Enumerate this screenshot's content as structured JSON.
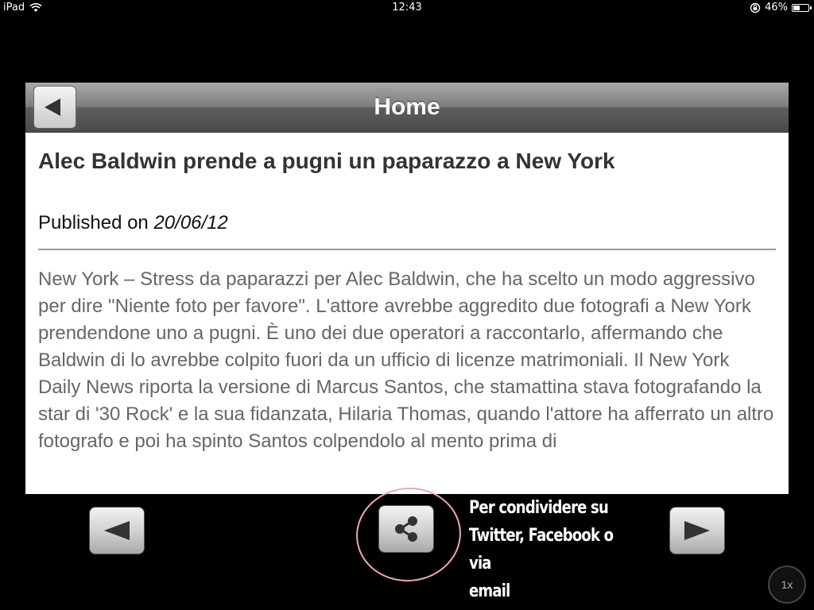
{
  "status_bar": {
    "device": "iPad",
    "time": "12:43",
    "battery": "46%",
    "battery_level": 0.46,
    "icons": [
      "wifi-icon",
      "orientation-lock-icon",
      "battery-icon"
    ]
  },
  "nav": {
    "title": "Home",
    "back_icon": "back-arrow-icon"
  },
  "article": {
    "title": "Alec Baldwin prende a pugni un paparazzo a New York",
    "published_label": "Published on",
    "published_date": "20/06/12",
    "body": "New York – Stress da paparazzi per Alec Baldwin, che ha scelto un modo aggressivo per dire \"Niente foto per favore\". L'attore avrebbe aggredito due fotografi a New York prendendone uno a pugni. È uno dei due operatori a raccontarlo, affermando che Baldwin di lo avrebbe colpito fuori da un ufficio di licenze matrimoniali. Il New York Daily News riporta la versione di Marcus Santos, che stamattina stava fotografando la star di '30 Rock' e la sua fidanzata, Hilaria Thomas, quando l'attore ha afferrato un altro fotografo e poi ha spinto Santos colpendolo al mento prima di"
  },
  "toolbar": {
    "prev_icon": "previous-arrow-icon",
    "share_icon": "share-icon",
    "next_icon": "next-arrow-icon",
    "share_hint_line1": "Per condividere su",
    "share_hint_line2": "Twitter, Facebook o via",
    "share_hint_line3": "email",
    "annotation_color": "#e8a9b1"
  },
  "zoom": {
    "label": "1x"
  }
}
